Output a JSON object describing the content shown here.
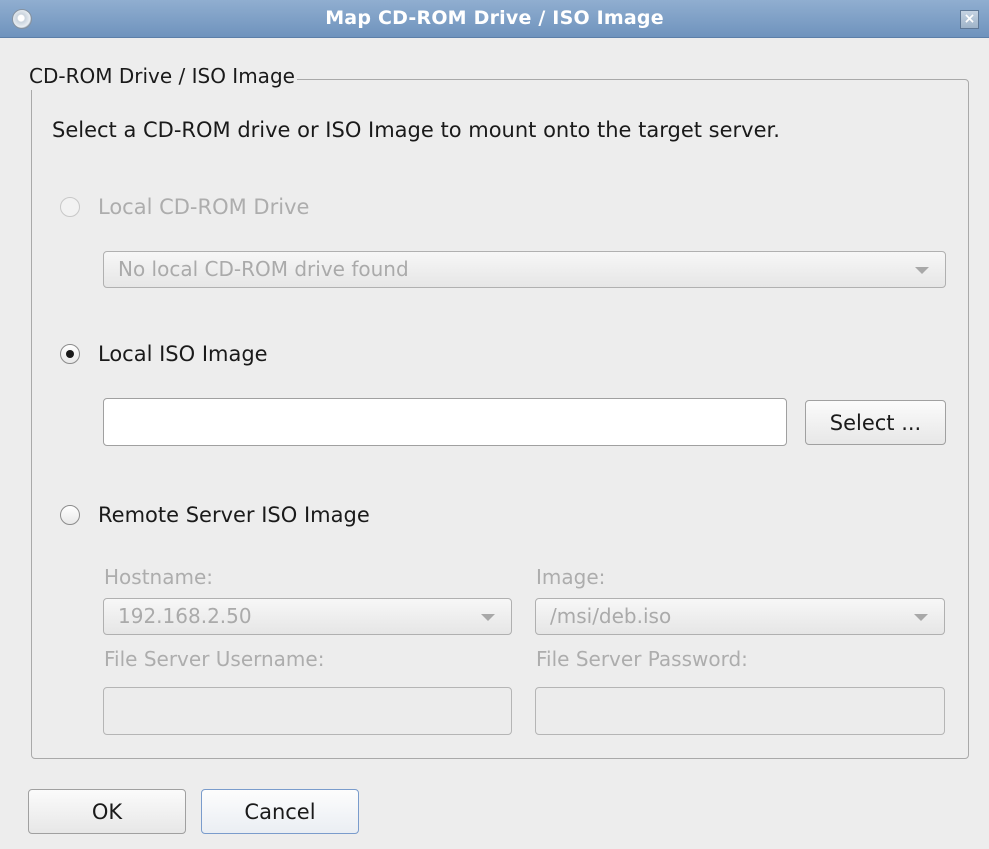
{
  "window": {
    "title": "Map CD-ROM Drive / ISO Image",
    "close_glyph": "×",
    "title_icon": "cd-icon",
    "accent_color": "#7a9cc6"
  },
  "group": {
    "title": "CD-ROM Drive / ISO Image",
    "instruction": "Select a CD-ROM drive or ISO Image to mount onto the target server."
  },
  "local_cdrom": {
    "label": "Local CD-ROM Drive",
    "selected": false,
    "enabled": false,
    "drive_value": "No local CD-ROM drive found"
  },
  "local_iso": {
    "label": "Local ISO Image",
    "selected": true,
    "enabled": true,
    "path_value": "",
    "select_button": "Select ..."
  },
  "remote_iso": {
    "label": "Remote Server ISO Image",
    "selected": false,
    "enabled": true,
    "hostname_label": "Hostname:",
    "hostname_value": "192.168.2.50",
    "image_label": "Image:",
    "image_value": "/msi/deb.iso",
    "username_label": "File Server Username:",
    "username_value": "",
    "password_label": "File Server Password:",
    "password_value": ""
  },
  "footer": {
    "ok_label": "OK",
    "cancel_label": "Cancel"
  }
}
